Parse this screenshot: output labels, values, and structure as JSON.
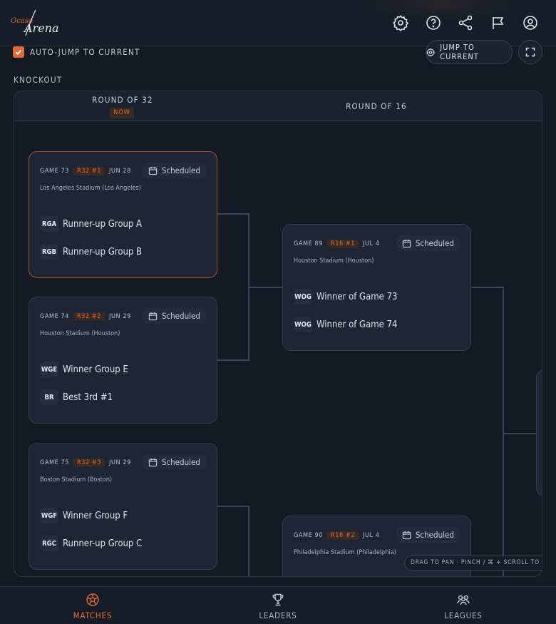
{
  "app": {
    "logo_text_1": "Ocaso",
    "logo_text_2": "Arena"
  },
  "header_icons": [
    "gear-icon",
    "help-icon",
    "share-icon",
    "flag-icon",
    "user-icon"
  ],
  "controls": {
    "auto_jump_label": "AUTO-JUMP TO CURRENT",
    "auto_jump_checked": true,
    "jump_button_label": "JUMP TO CURRENT"
  },
  "section_title": "KNOCKOUT",
  "rounds": [
    {
      "title": "ROUND OF 32",
      "badge": "NOW"
    },
    {
      "title": "ROUND OF 16"
    }
  ],
  "matches": [
    {
      "game": "GAME 73",
      "tag": "R32 #1",
      "date": "JUN 28",
      "status": "Scheduled",
      "venue": "Los Angeles Stadium (Los Angeles)",
      "current": true,
      "teams": [
        {
          "code": "RGA",
          "name": "Runner-up Group A"
        },
        {
          "code": "RGB",
          "name": "Runner-up Group B"
        }
      ]
    },
    {
      "game": "GAME 74",
      "tag": "R32 #2",
      "date": "JUN 29",
      "status": "Scheduled",
      "venue": "Houston Stadium (Houston)",
      "teams": [
        {
          "code": "WGE",
          "name": "Winner Group E"
        },
        {
          "code": "BR",
          "name": "Best 3rd #1"
        }
      ]
    },
    {
      "game": "GAME 75",
      "tag": "R32 #3",
      "date": "JUN 29",
      "status": "Scheduled",
      "venue": "Boston Stadium (Boston)",
      "teams": [
        {
          "code": "WGF",
          "name": "Winner Group F"
        },
        {
          "code": "RGC",
          "name": "Runner-up Group C"
        }
      ]
    },
    {
      "game": "GAME 89",
      "tag": "R16 #1",
      "date": "JUL 4",
      "status": "Scheduled",
      "venue": "Houston Stadium (Houston)",
      "teams": [
        {
          "code": "WOG",
          "name": "Winner of Game 73"
        },
        {
          "code": "WOG",
          "name": "Winner of Game 74"
        }
      ]
    },
    {
      "game": "GAME 90",
      "tag": "R16 #2",
      "date": "JUL 4",
      "status": "Scheduled",
      "venue": "Philadelphia Stadium (Philadelphia)",
      "teams": []
    }
  ],
  "zoom_hint": "DRAG TO PAN · PINCH / ⌘ + SCROLL TO ZOOM",
  "bottom_nav": [
    {
      "label": "MATCHES",
      "icon": "soccer-ball-icon",
      "active": true
    },
    {
      "label": "LEADERS",
      "icon": "trophy-icon"
    },
    {
      "label": "LEAGUES",
      "icon": "group-icon"
    }
  ],
  "colors": {
    "accent": "#e06a33",
    "background": "#141a24",
    "card": "#1e2635"
  }
}
